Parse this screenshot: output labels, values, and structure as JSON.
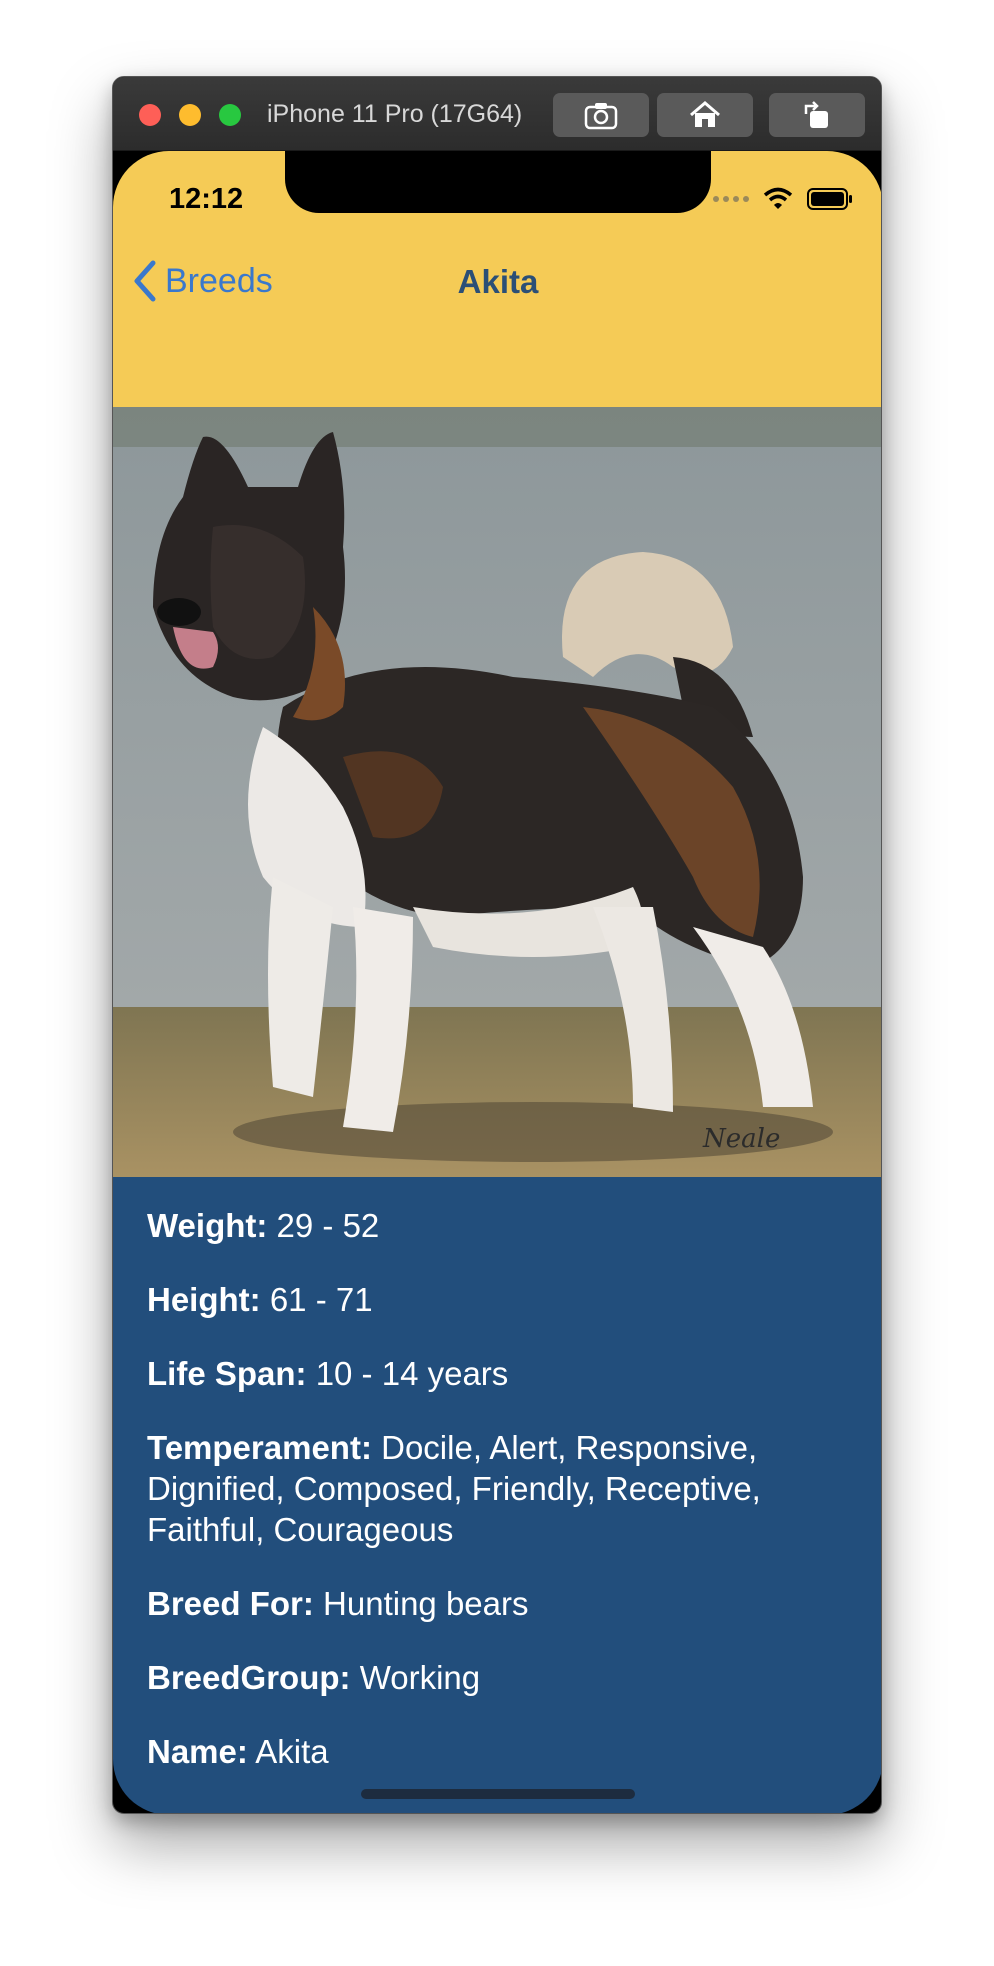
{
  "window": {
    "title": "iPhone 11 Pro (17G64)",
    "buttons": [
      "screenshot-icon",
      "home-icon",
      "rotate-icon"
    ]
  },
  "status_bar": {
    "time": "12:12"
  },
  "nav": {
    "back_label": "Breeds",
    "title": "Akita"
  },
  "photo": {
    "subject": "dog-photo",
    "signature": "Neale"
  },
  "details": [
    {
      "label": "Weight:",
      "value": "29 - 52"
    },
    {
      "label": "Height:",
      "value": "61 - 71"
    },
    {
      "label": "Life Span:",
      "value": "10 - 14 years"
    },
    {
      "label": "Temperament:",
      "value": "Docile, Alert, Responsive, Dignified, Composed, Friendly, Receptive, Faithful, Courageous"
    },
    {
      "label": "Breed For:",
      "value": "Hunting bears"
    },
    {
      "label": "BreedGroup:",
      "value": "Working"
    },
    {
      "label": "Name:",
      "value": "Akita"
    }
  ],
  "colors": {
    "header": "#f5cb56",
    "content_bg": "#224e7c",
    "back_link": "#3a78cc",
    "nav_title": "#2b4f76"
  }
}
